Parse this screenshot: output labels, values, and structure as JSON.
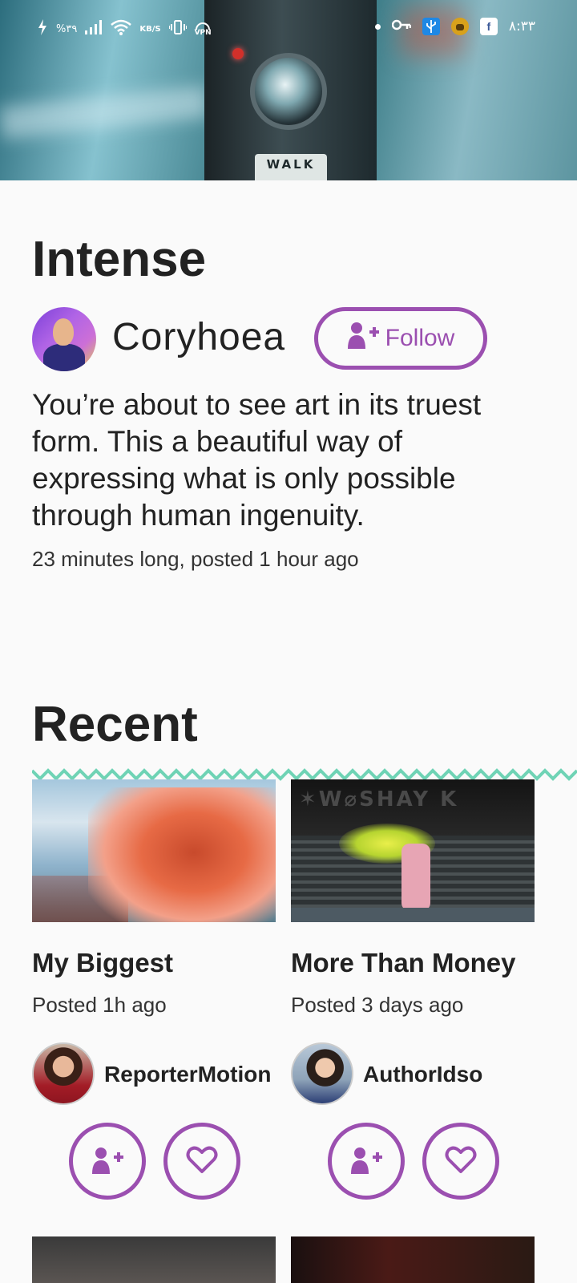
{
  "status_bar": {
    "battery": "%۳۹",
    "speed_unit": "KB/S",
    "vpn": "VPN",
    "time": "۸:۳۳"
  },
  "hero": {
    "sign_text": "WALK"
  },
  "feature": {
    "title": "Intense",
    "author": "Coryhoea",
    "follow_label": "Follow",
    "description": "You’re about to see art in its truest form. This a beautiful way of expressing what is only possible through human ingenuity.",
    "meta": "23 minutes long, posted 1 hour ago"
  },
  "recent": {
    "title": "Recent",
    "items": [
      {
        "title": "My Biggest",
        "posted": "Posted 1h ago",
        "author": "ReporterMotion"
      },
      {
        "title": "More Than Money",
        "posted": "Posted 3 days ago",
        "author": "AuthorIdso"
      }
    ]
  },
  "colors": {
    "accent": "#9b4fb0",
    "zigzag": "#6fd3b5"
  },
  "icons": [
    "charging-icon",
    "signal-icon",
    "wifi-icon",
    "vibrate-icon",
    "vpn-icon",
    "dot-icon",
    "key-icon",
    "usb-icon",
    "app-icon",
    "facebook-icon",
    "user-plus-icon",
    "heart-icon"
  ]
}
